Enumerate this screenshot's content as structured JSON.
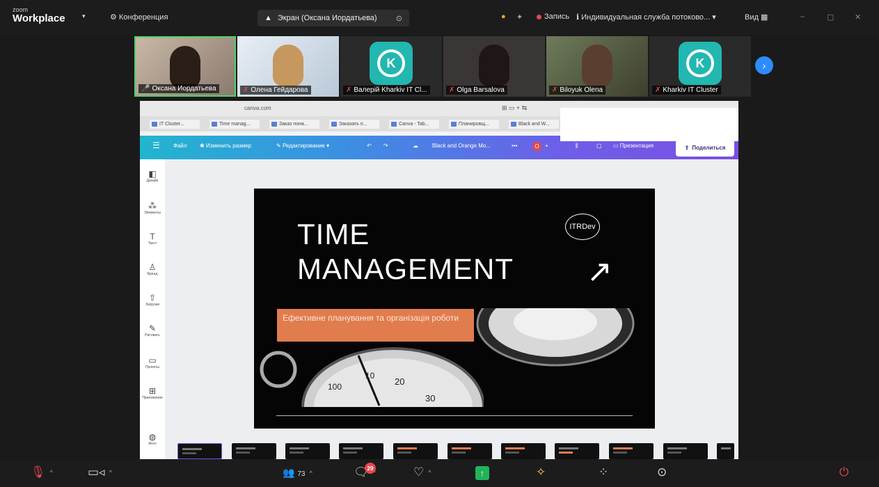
{
  "app": {
    "brand_small": "zoom",
    "brand": "Workplace",
    "meeting_menu": "Конференция"
  },
  "topbar": {
    "screen_label": "Экран (Оксана Иордатьева)",
    "record_label": "Запись",
    "service_label": "Индивидуальная служба потоково...",
    "view_label": "Вид"
  },
  "participants": [
    {
      "name": "Оксана Иордатьева"
    },
    {
      "name": "Олена Гейдарова"
    },
    {
      "name": "Валерій Kharkiv IT Cl..."
    },
    {
      "name": "Olga Barsalova"
    },
    {
      "name": "Biloyuk Olena"
    },
    {
      "name": "Kharkiv IT Cluster"
    }
  ],
  "browser": {
    "url": "canva.com",
    "tabs": [
      "IT Cluster...",
      "Time manag...",
      "Заказ пона...",
      "Заказать п...",
      "Canva - Tab...",
      "Планировщ...",
      "Black and W..."
    ]
  },
  "canva": {
    "home": "Файл",
    "resize": "Изменить размер",
    "editing": "Редактирование",
    "doc_title": "Black and Orange Mo...",
    "present": "Презентация",
    "share": "Поделиться",
    "sidebar": [
      "Дизайн",
      "Элементы",
      "Текст",
      "Бренд",
      "Загрузки",
      "Рисовать",
      "Проекты",
      "Приложения",
      "Фото"
    ]
  },
  "slide": {
    "line1": "TIME",
    "line2": "MANAGEMENT",
    "badge": "ITRDev",
    "subtitle": "Ефективне планування та організація роботи",
    "dial": [
      "100",
      "10",
      "20",
      "30"
    ]
  },
  "bottombar": {
    "participants_count": "73",
    "chat_badge": "29"
  },
  "colors": {
    "accent_orange": "#e07c4e",
    "zoom_blue": "#2d8cff",
    "active_green": "#4fd168",
    "share_green": "#21b35a"
  }
}
